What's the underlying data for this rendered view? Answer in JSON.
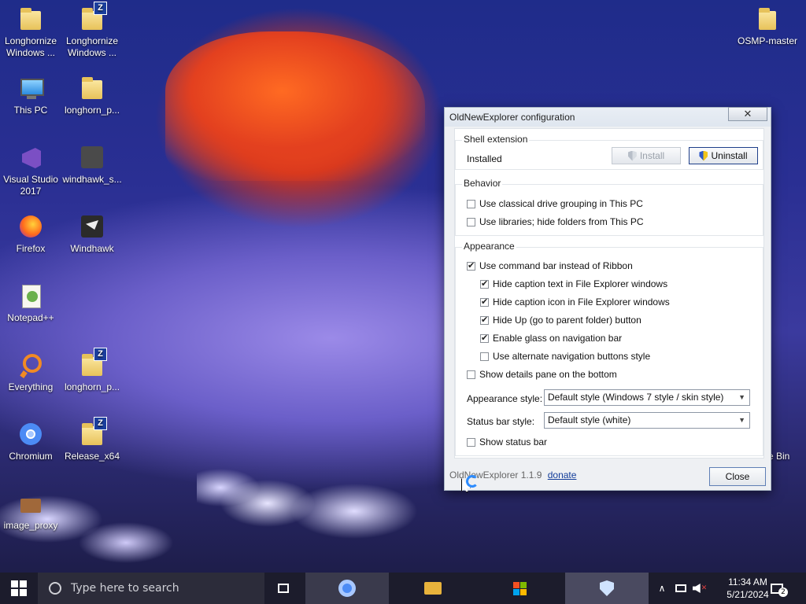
{
  "desktop": {
    "icons": [
      {
        "label": "Longhornize Windows ..."
      },
      {
        "label": "Longhornize Windows ..."
      },
      {
        "label": "This PC"
      },
      {
        "label": "longhorn_p..."
      },
      {
        "label": "Visual Studio 2017"
      },
      {
        "label": "windhawk_s..."
      },
      {
        "label": "Firefox"
      },
      {
        "label": "Windhawk"
      },
      {
        "label": "Notepad++"
      },
      {
        "label": "Everything"
      },
      {
        "label": "longhorn_p..."
      },
      {
        "label": "Chromium"
      },
      {
        "label": "Release_x64"
      },
      {
        "label": "image_proxy"
      },
      {
        "label": "OSMP-master"
      },
      {
        "label": "e Bin"
      }
    ]
  },
  "dialog": {
    "title": "OldNewExplorer configuration",
    "close_symbol": "✕",
    "shell": {
      "legend": "Shell extension",
      "status": "Installed",
      "install_label": "Install",
      "uninstall_label": "Uninstall"
    },
    "behavior": {
      "legend": "Behavior",
      "options": [
        {
          "label": "Use classical drive grouping in This PC",
          "checked": false
        },
        {
          "label": "Use libraries; hide folders from This PC",
          "checked": false
        }
      ]
    },
    "appearance": {
      "legend": "Appearance",
      "options": [
        {
          "label": "Use command bar instead of Ribbon",
          "checked": true
        },
        {
          "label": "Hide caption text in File Explorer windows",
          "checked": true
        },
        {
          "label": "Hide caption icon in File Explorer windows",
          "checked": true
        },
        {
          "label": "Hide Up (go to parent folder) button",
          "checked": true
        },
        {
          "label": "Enable glass on navigation bar",
          "checked": true
        },
        {
          "label": "Use alternate navigation buttons style",
          "checked": false
        },
        {
          "label": "Show details pane on the bottom",
          "checked": false
        }
      ],
      "appearance_style_label": "Appearance style:",
      "appearance_style_value": "Default style (Windows 7 style / skin style)",
      "status_bar_style_label": "Status bar style:",
      "status_bar_style_value": "Default style (white)",
      "show_status_bar": {
        "label": "Show status bar",
        "checked": false
      }
    },
    "footer": {
      "version": "OldNewExplorer 1.1.9",
      "donate": "donate",
      "close_label": "Close"
    }
  },
  "taskbar": {
    "search_placeholder": "Type here to search",
    "time": "11:34 AM",
    "date": "5/21/2024",
    "notification_count": "2"
  },
  "colors": {
    "accent": "#1b3f9e",
    "taskbar": "#1c1c2c",
    "shield_blue": "#2c57c8",
    "shield_yellow": "#f0c419"
  }
}
